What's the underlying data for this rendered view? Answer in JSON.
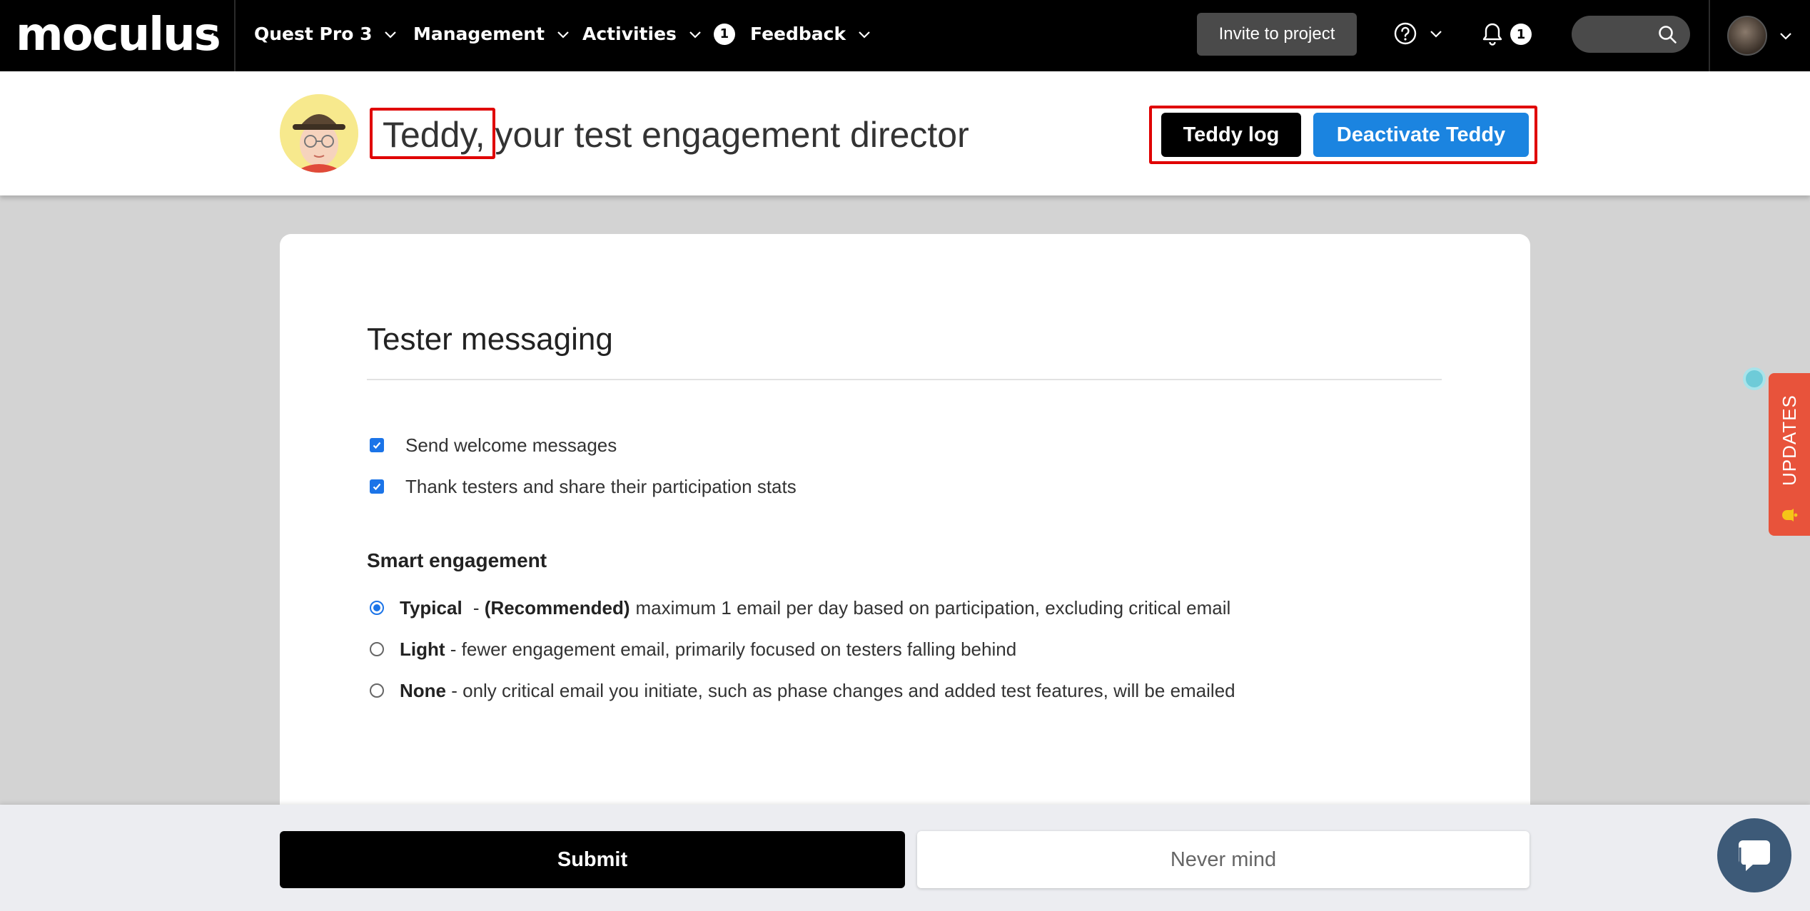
{
  "nav": {
    "logo": "moculus",
    "items": [
      {
        "label": "Quest Pro 3"
      },
      {
        "label": "Management"
      },
      {
        "label": "Activities",
        "badge": "1"
      },
      {
        "label": "Feedback"
      }
    ],
    "invite_label": "Invite to project",
    "notifications_badge": "1"
  },
  "header": {
    "title": "Teddy, your test engagement director",
    "teddy_log_label": "Teddy log",
    "deactivate_label": "Deactivate Teddy"
  },
  "messaging": {
    "title": "Tester messaging",
    "checkboxes": [
      {
        "label": "Send welcome messages",
        "checked": true
      },
      {
        "label": "Thank testers and share their participation stats",
        "checked": true
      }
    ],
    "smart_engagement_title": "Smart engagement",
    "radios": [
      {
        "label": "Typical",
        "sep": " - ",
        "tag": "(Recommended)",
        "desc": "maximum 1 email per day based on participation, excluding critical email",
        "selected": true
      },
      {
        "label": "Light",
        "sep": " - ",
        "desc": "fewer engagement email, primarily focused on testers falling behind",
        "selected": false
      },
      {
        "label": "None",
        "sep": " - ",
        "desc": "only critical email you initiate, such as phase changes and added test features, will be emailed",
        "selected": false
      }
    ]
  },
  "footer": {
    "submit_label": "Submit",
    "nevermind_label": "Never mind"
  },
  "updates_label": "UPDATES",
  "colors": {
    "nav_bg": "#000000",
    "primary_blue": "#1b84e0",
    "highlight_red": "#e00000",
    "updates_orange": "#e8533b"
  },
  "icons": [
    "chevron-down-icon",
    "help-icon",
    "bell-icon",
    "search-icon",
    "chat-icon",
    "bell-updates-icon"
  ]
}
